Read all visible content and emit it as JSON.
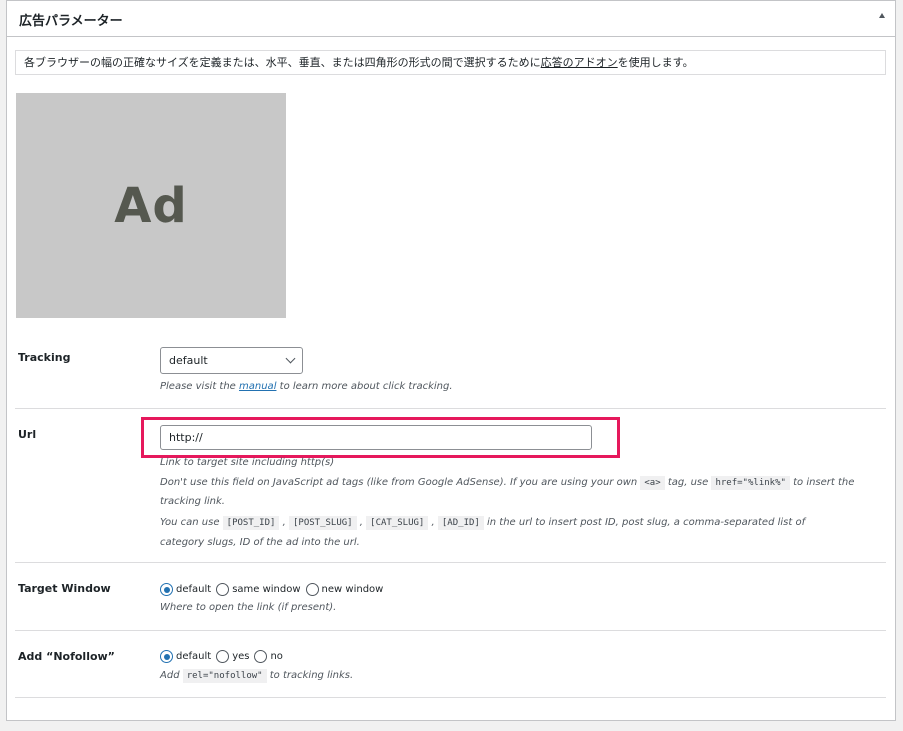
{
  "panel": {
    "title": "広告パラメーター"
  },
  "notice": {
    "text_before": "各ブラウザーの幅の正確なサイズを定義または、水平、垂直、または四角形の形式の間で選択するために",
    "link_text": "応答のアドオン",
    "text_after": "を使用します。"
  },
  "ad_preview": {
    "label": "Ad"
  },
  "tracking": {
    "label": "Tracking",
    "selected": "default",
    "desc_before": "Please visit the ",
    "desc_link": "manual",
    "desc_after": " to learn more about click tracking."
  },
  "url": {
    "label": "Url",
    "value": "http://",
    "desc1": "Link to target site including http(s)",
    "desc2_before": "Don't use this field on JavaScript ad tags (like from Google AdSense). If you are using your own ",
    "desc2_code1": "<a>",
    "desc2_mid": " tag, use ",
    "desc2_code2": "href=\"%link%\"",
    "desc2_after": " to insert the",
    "desc2_line2": "tracking link.",
    "desc3_before": "You can use ",
    "desc3_codes": [
      "[POST_ID]",
      "[POST_SLUG]",
      "[CAT_SLUG]",
      "[AD_ID]"
    ],
    "desc3_after": " in the url to insert post ID, post slug, a comma-separated list of",
    "desc3_line2": "category slugs, ID of the ad into the url."
  },
  "target_window": {
    "label": "Target Window",
    "options": [
      "default",
      "same window",
      "new window"
    ],
    "selected": "default",
    "desc": "Where to open the link (if present)."
  },
  "nofollow": {
    "label": "Add “Nofollow”",
    "options": [
      "default",
      "yes",
      "no"
    ],
    "selected": "default",
    "desc_before": "Add ",
    "desc_code": "rel=\"nofollow\"",
    "desc_after": " to tracking links."
  },
  "colors": {
    "highlight": "#e6185c",
    "accent": "#2271b1",
    "ad_placeholder": "#c8c8c8"
  }
}
